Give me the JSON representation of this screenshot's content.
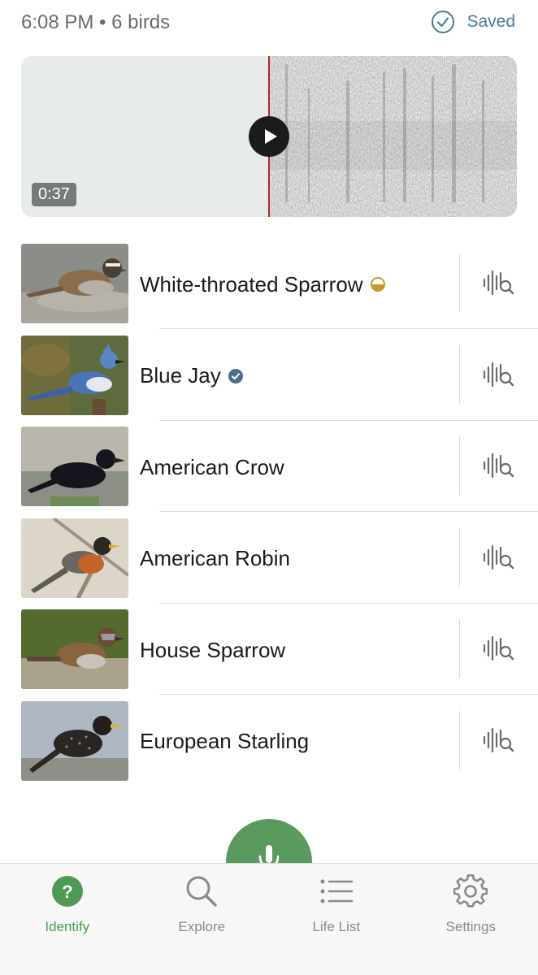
{
  "header": {
    "session_info": "6:08 PM • 6 birds",
    "saved_label": "Saved",
    "saved_icon": "check-circle-icon"
  },
  "recording": {
    "duration": "0:37",
    "play_icon": "play-icon",
    "playhead_color": "#b4262c"
  },
  "birds": [
    {
      "name": "White-throated Sparrow",
      "badge": "half-circle-icon",
      "action_icon": "spectrogram-search-icon"
    },
    {
      "name": "Blue Jay",
      "badge": "verified-check-icon",
      "action_icon": "spectrogram-search-icon"
    },
    {
      "name": "American Crow",
      "badge": null,
      "action_icon": "spectrogram-search-icon"
    },
    {
      "name": "American Robin",
      "badge": null,
      "action_icon": "spectrogram-search-icon"
    },
    {
      "name": "House Sparrow",
      "badge": null,
      "action_icon": "spectrogram-search-icon"
    },
    {
      "name": "European Starling",
      "badge": null,
      "action_icon": "spectrogram-search-icon"
    }
  ],
  "mic": {
    "icon": "microphone-icon",
    "color": "#5a9a5e"
  },
  "tabs": [
    {
      "label": "Identify",
      "icon": "question-circle-icon",
      "active": true
    },
    {
      "label": "Explore",
      "icon": "search-icon",
      "active": false
    },
    {
      "label": "Life List",
      "icon": "list-icon",
      "active": false
    },
    {
      "label": "Settings",
      "icon": "gear-icon",
      "active": false
    }
  ],
  "colors": {
    "accent_green": "#4e9a52",
    "saved_blue": "#4a7a9b",
    "half_badge": "#c9962b",
    "verified_badge": "#4d6d8a"
  }
}
